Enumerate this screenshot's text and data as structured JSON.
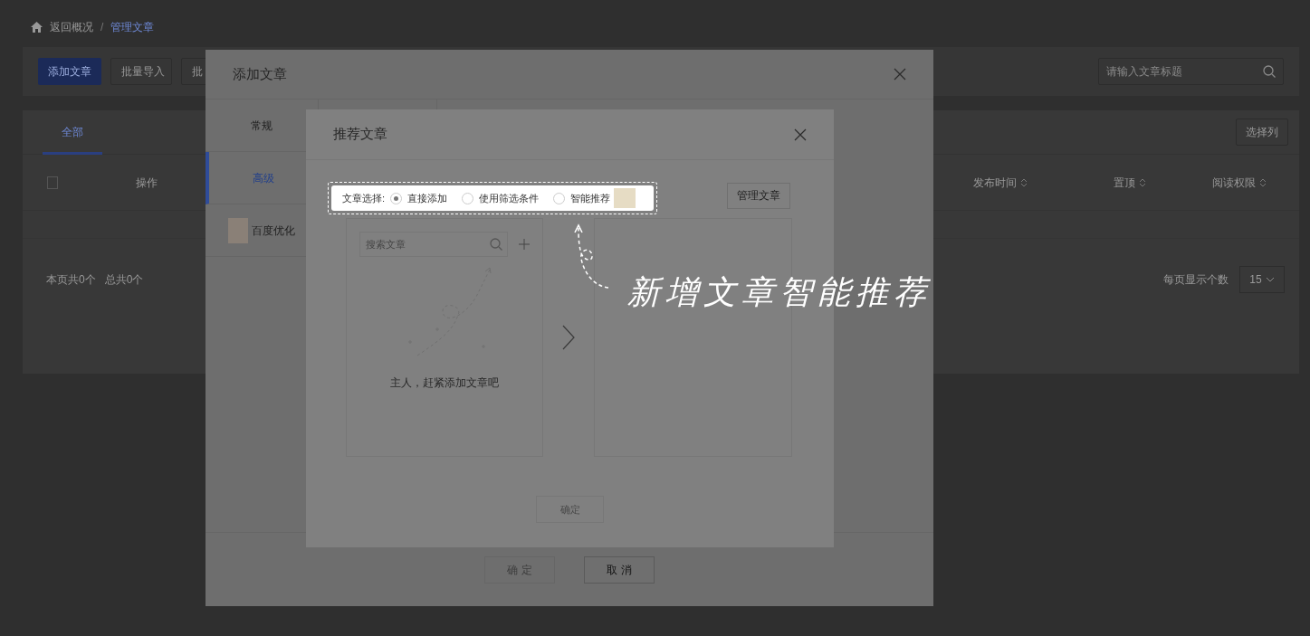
{
  "breadcrumb": [
    {
      "label": "返回概况",
      "selected": false
    },
    {
      "label": "管理文章",
      "selected": true
    }
  ],
  "breadcrumb_separator": "/",
  "toolbar": {
    "buttons": [
      {
        "label": "添加文章",
        "kind": "primary"
      },
      {
        "label": "批量导入",
        "kind": "default"
      },
      {
        "label": "批",
        "kind": "default"
      }
    ],
    "search": {
      "placeholder": "请输入文章标题"
    }
  },
  "tabs": [
    {
      "label": "全部",
      "selected": true
    }
  ],
  "column_picker": "选择列",
  "table": {
    "select_all": {
      "checked": false
    },
    "columns": [
      {
        "label": "操作",
        "sortable": false
      },
      {
        "label": "发布时间",
        "sortable": true
      },
      {
        "label": "置顶",
        "sortable": true
      },
      {
        "label": "阅读权限",
        "sortable": true
      }
    ]
  },
  "footer": {
    "page_count": "本页共0个",
    "total_count": "总共0个",
    "page_size_label": "每页显示个数",
    "page_size": "15"
  },
  "add_dialog": {
    "title": "添加文章",
    "nav": [
      {
        "label": "常规",
        "selected": false,
        "kind": "text"
      },
      {
        "label": "高级",
        "selected": true,
        "kind": "text"
      },
      {
        "label": "百度优化",
        "selected": false,
        "kind": "thumb"
      }
    ],
    "buttons": [
      {
        "label": "确 定",
        "disabled": true
      },
      {
        "label": "取 消",
        "disabled": false
      }
    ]
  },
  "recommend_dialog": {
    "title": "推荐文章",
    "source": {
      "label": "文章选择:",
      "options": [
        {
          "label": "直接添加",
          "selected": true,
          "kind": "plain"
        },
        {
          "label": "使用筛选条件",
          "selected": false,
          "kind": "plain"
        },
        {
          "label": "智能推荐",
          "selected": false,
          "kind": "thumb"
        }
      ]
    },
    "manage_button": "管理文章",
    "search": {
      "placeholder": "搜索文章"
    },
    "empty_text": "主人，赶紧添加文章吧",
    "confirm": {
      "label": "确定",
      "disabled": true
    }
  },
  "annotation": {
    "text": "新增文章智能推荐"
  }
}
